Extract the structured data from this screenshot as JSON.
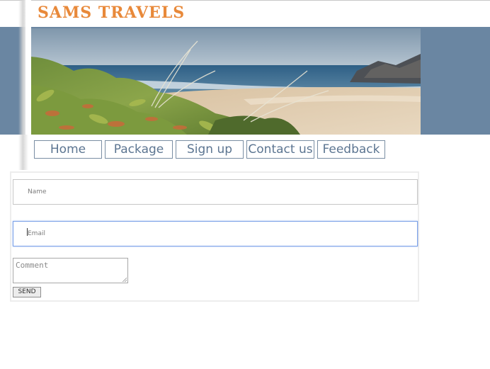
{
  "site": {
    "title": "SAMS TRAVELS"
  },
  "colors": {
    "title": "#e8893a",
    "header_bar": "#6a86a2",
    "nav_text": "#5c7591",
    "nav_border": "#7a8ea3",
    "focus_border": "#7aa0e8"
  },
  "banner": {
    "image": "beach-with-coastal-plants-photo"
  },
  "nav": {
    "items": [
      {
        "label": "Home"
      },
      {
        "label": "Package"
      },
      {
        "label": "Sign up"
      },
      {
        "label": "Contact us"
      },
      {
        "label": "Feedback"
      }
    ]
  },
  "form": {
    "name": {
      "placeholder": "Name",
      "value": ""
    },
    "email": {
      "placeholder": "Email",
      "value": "",
      "focused": true
    },
    "comment": {
      "placeholder": "Comment",
      "value": ""
    },
    "send_label": "SEND"
  }
}
